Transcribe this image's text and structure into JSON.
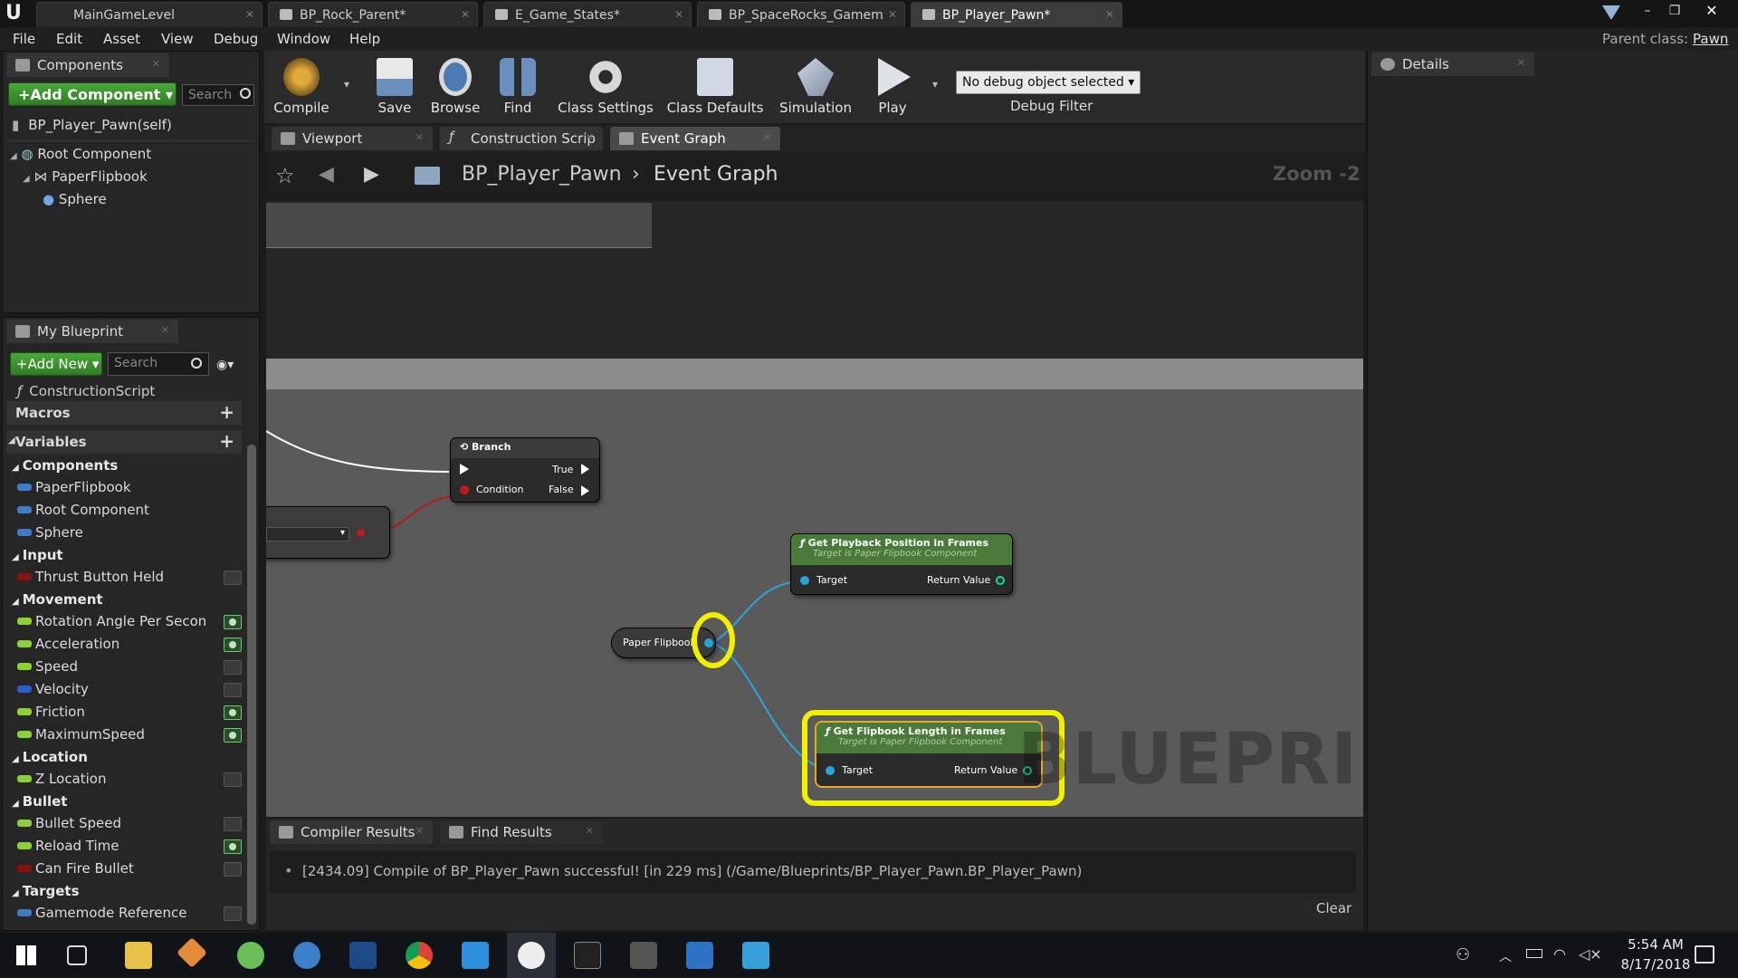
{
  "window": {
    "tabs": [
      {
        "label": "MainGameLevel"
      },
      {
        "label": "BP_Rock_Parent*"
      },
      {
        "label": "E_Game_States*"
      },
      {
        "label": "BP_SpaceRocks_Gamem"
      },
      {
        "label": "BP_Player_Pawn*"
      }
    ],
    "parent_class_label": "Parent class:",
    "parent_class_value": "Pawn"
  },
  "menu": [
    "File",
    "Edit",
    "Asset",
    "View",
    "Debug",
    "Window",
    "Help"
  ],
  "components_panel": {
    "tab": "Components",
    "add_button": "+Add Component",
    "search_placeholder": "Search",
    "self": "BP_Player_Pawn(self)",
    "tree": [
      "Root Component",
      "PaperFlipbook",
      "Sphere"
    ]
  },
  "toolbar": {
    "buttons": [
      "Compile",
      "Save",
      "Browse",
      "Find",
      "Class Settings",
      "Class Defaults",
      "Simulation",
      "Play"
    ],
    "debug_select": "No debug object selected",
    "debug_filter": "Debug Filter"
  },
  "editor_tabs": [
    "Viewport",
    "Construction Scrip",
    "Event Graph"
  ],
  "breadcrumb": {
    "root": "BP_Player_Pawn",
    "current": "Event Graph",
    "zoom": "Zoom -2"
  },
  "my_blueprint": {
    "tab": "My Blueprint",
    "add_new": "+Add New",
    "search_placeholder": "Search",
    "construction_script": "ConstructionScript",
    "macros": "Macros",
    "variables": "Variables",
    "categories": [
      {
        "name": "Components",
        "items": [
          {
            "label": "PaperFlipbook",
            "color": "#3d7cc9",
            "eye": null
          },
          {
            "label": "Root Component",
            "color": "#3d7cc9",
            "eye": null
          },
          {
            "label": "Sphere",
            "color": "#3d7cc9",
            "eye": null
          }
        ]
      },
      {
        "name": "Input",
        "items": [
          {
            "label": "Thrust Button Held",
            "color": "#8b1010",
            "eye": false
          }
        ]
      },
      {
        "name": "Movement",
        "items": [
          {
            "label": "Rotation Angle Per Secon",
            "color": "#8bd035",
            "eye": true
          },
          {
            "label": "Acceleration",
            "color": "#8bd035",
            "eye": true
          },
          {
            "label": "Speed",
            "color": "#8bd035",
            "eye": false
          },
          {
            "label": "Velocity",
            "color": "#2d5fc8",
            "eye": false
          },
          {
            "label": "Friction",
            "color": "#8bd035",
            "eye": true
          },
          {
            "label": "MaximumSpeed",
            "color": "#8bd035",
            "eye": true
          }
        ]
      },
      {
        "name": "Location",
        "items": [
          {
            "label": "Z Location",
            "color": "#8bd035",
            "eye": false
          }
        ]
      },
      {
        "name": "Bullet",
        "items": [
          {
            "label": "Bullet Speed",
            "color": "#8bd035",
            "eye": false
          },
          {
            "label": "Reload Time",
            "color": "#8bd035",
            "eye": true
          },
          {
            "label": "Can Fire Bullet",
            "color": "#8b1010",
            "eye": false
          }
        ]
      },
      {
        "name": "Targets",
        "items": [
          {
            "label": "Gamemode Reference",
            "color": "#3d7cc9",
            "eye": false
          }
        ]
      }
    ]
  },
  "graph": {
    "watermark": "BLUEPRINT",
    "branch": {
      "title": "Branch",
      "true": "True",
      "false": "False",
      "condition": "Condition"
    },
    "paper_flipbook": "Paper Flipbook",
    "playback_node": {
      "title": "Get Playback Position in Frames",
      "subtitle": "Target is Paper Flipbook Component",
      "target": "Target",
      "return": "Return Value"
    },
    "length_node": {
      "title": "Get Flipbook Length in Frames",
      "subtitle": "Target is Paper Flipbook Component",
      "target": "Target",
      "return": "Return Value"
    }
  },
  "bottom": {
    "tabs": [
      "Compiler Results",
      "Find Results"
    ],
    "message": "[2434.09] Compile of BP_Player_Pawn successful! [in 229 ms] (/Game/Blueprints/BP_Player_Pawn.BP_Player_Pawn)",
    "clear": "Clear"
  },
  "details": {
    "tab": "Details"
  },
  "taskbar": {
    "time": "5:54 AM",
    "date": "8/17/2018"
  },
  "colors": {
    "accent_green": "#3d9a30",
    "highlight": "#f2ef00",
    "function_header": "#4a7a3a",
    "exec_wire": "#ffffff",
    "object_wire": "#2aa4d8"
  }
}
